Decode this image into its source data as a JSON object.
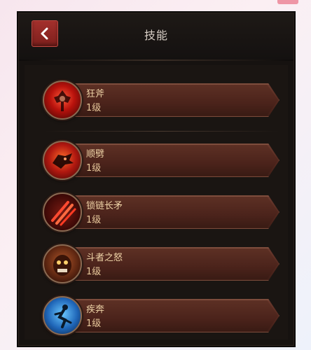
{
  "header": {
    "title": "技能",
    "back_icon": "chevron-left-icon"
  },
  "skills": [
    {
      "name": "狂斧",
      "level": "1级",
      "icon": "axe-icon",
      "color": "#c7281c"
    },
    {
      "name": "顺劈",
      "level": "1级",
      "icon": "wolf-head-icon",
      "color": "#b8201a"
    },
    {
      "name": "锁链长矛",
      "level": "1级",
      "icon": "claw-slash-icon",
      "color": "#c22a20"
    },
    {
      "name": "斗者之怒",
      "level": "1级",
      "icon": "demon-face-icon",
      "color": "#7a3a22"
    },
    {
      "name": "疾奔",
      "level": "1级",
      "icon": "running-man-icon",
      "color": "#1f66b8"
    }
  ]
}
